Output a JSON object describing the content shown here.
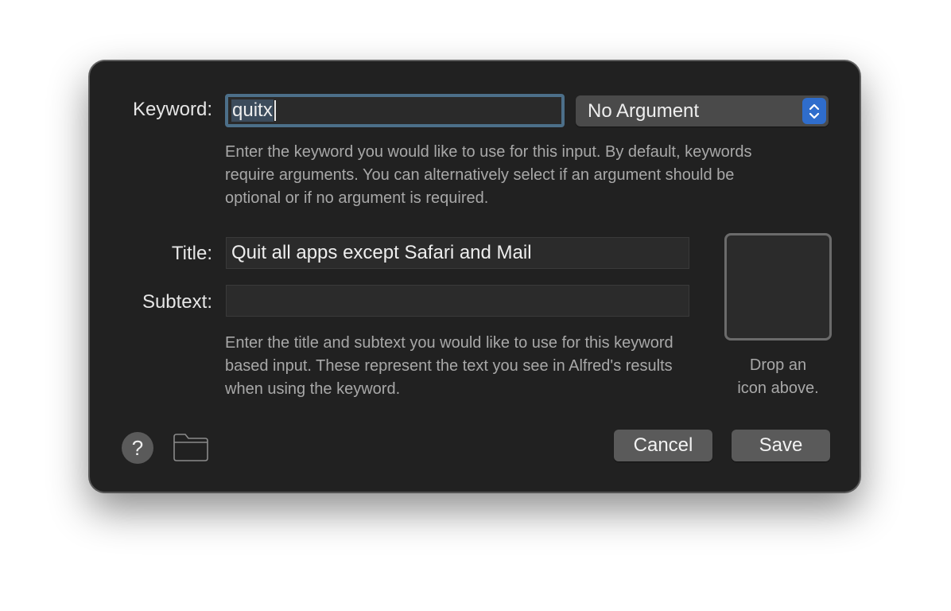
{
  "keyword": {
    "label": "Keyword:",
    "value": "quitx",
    "argument_option": "No Argument",
    "help": "Enter the keyword you would like to use for this input. By default, keywords require arguments. You can alternatively select if an argument should be optional or if no argument is required."
  },
  "title": {
    "label": "Title:",
    "value": "Quit all apps except Safari and Mail"
  },
  "subtext": {
    "label": "Subtext:",
    "value": ""
  },
  "title_help": "Enter the title and subtext you would like to use for this keyword based input. These represent the text you see in Alfred's results when using the keyword.",
  "icon_well": {
    "caption_line1": "Drop an",
    "caption_line2": "icon above."
  },
  "footer": {
    "help_glyph": "?",
    "cancel_label": "Cancel",
    "save_label": "Save"
  },
  "icons": {
    "help": "question-icon",
    "folder": "folder-icon",
    "stepper": "chevron-up-down-icon"
  },
  "colors": {
    "dialog_bg": "#212121",
    "focus_ring": "#4c6f89",
    "stepper_accent": "#2f6dcc",
    "button_bg": "#5a5a5a"
  }
}
